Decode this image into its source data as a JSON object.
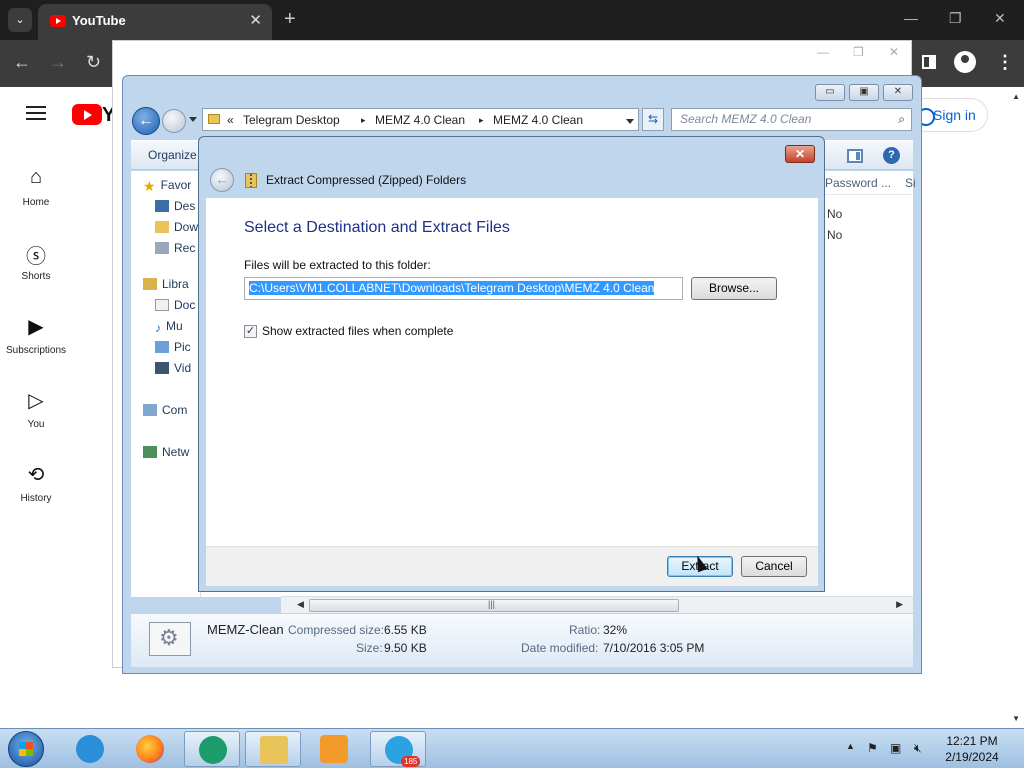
{
  "browser": {
    "tab_title": "YouTube",
    "tab_close": "✕",
    "new_tab": "+",
    "menu_chevron": "⌄",
    "minimize": "—",
    "restore": "❐",
    "close": "✕",
    "back": "←",
    "forward": "→",
    "reload": "↻",
    "kebab": "⋮"
  },
  "youtube": {
    "logo_letter": "Y",
    "sign_in": "Sign in",
    "nav": [
      {
        "label": "Home",
        "icon": "home-icon",
        "glyph": "⌂"
      },
      {
        "label": "Shorts",
        "icon": "shorts-icon",
        "glyph": "ⓢ"
      },
      {
        "label": "Subscriptions",
        "icon": "subscriptions-icon",
        "glyph": "▶"
      },
      {
        "label": "You",
        "icon": "you-icon",
        "glyph": "▷"
      },
      {
        "label": "History",
        "icon": "history-icon",
        "glyph": "⟲"
      }
    ]
  },
  "explorer": {
    "window_buttons": {
      "minimize": "▭",
      "maximize": "▣",
      "close": "✕"
    },
    "address_chevrons": "«",
    "breadcrumb": [
      "Telegram Desktop",
      "MEMZ 4.0 Clean",
      "MEMZ 4.0 Clean"
    ],
    "breadcrumb_sep": "▸",
    "search_placeholder": "Search MEMZ 4.0 Clean",
    "organize": "Organize",
    "help": "?",
    "nav_pane": [
      {
        "label": "Favor",
        "icon": "star-icon"
      },
      {
        "label": "Des",
        "icon": "desktop-icon"
      },
      {
        "label": "Dow",
        "icon": "downloads-icon"
      },
      {
        "label": "Rec",
        "icon": "recent-places-icon"
      },
      {
        "label": "Libra",
        "icon": "libraries-icon"
      },
      {
        "label": "Doc",
        "icon": "documents-icon"
      },
      {
        "label": "Mu",
        "icon": "music-icon"
      },
      {
        "label": "Pic",
        "icon": "pictures-icon"
      },
      {
        "label": "Vid",
        "icon": "videos-icon"
      },
      {
        "label": "Com",
        "icon": "computer-icon"
      },
      {
        "label": "Netw",
        "icon": "network-icon"
      }
    ],
    "columns": [
      "Password ...",
      "Si"
    ],
    "cells": [
      "No",
      "No"
    ],
    "details": {
      "name": "MEMZ-Clean",
      "compressed_label": "Compressed size:",
      "compressed_value": "6.55 KB",
      "size_label": "Size:",
      "size_value": "9.50 KB",
      "ratio_label": "Ratio:",
      "ratio_value": "32%",
      "modified_label": "Date modified:",
      "modified_value": "7/10/2016 3:05 PM"
    }
  },
  "dialog": {
    "title": "Extract Compressed (Zipped) Folders",
    "close": "✕",
    "heading": "Select a Destination and Extract Files",
    "folder_label": "Files will be extracted to this folder:",
    "path": "C:\\Users\\VM1.COLLABNET\\Downloads\\Telegram Desktop\\MEMZ 4.0 Clean",
    "browse": "Browse...",
    "checkbox_label": "Show extracted files when complete",
    "checkbox_checked": true,
    "extract": "Extract",
    "cancel": "Cancel"
  },
  "taskbar": {
    "apps": [
      {
        "name": "internet-explorer",
        "color": "#2a8fd8"
      },
      {
        "name": "firefox",
        "color": "#ff7a1a"
      },
      {
        "name": "app-green",
        "color": "#1b9c6a"
      },
      {
        "name": "file-explorer",
        "color": "#e8c45a"
      },
      {
        "name": "media-player",
        "color": "#f39b2a"
      },
      {
        "name": "telegram",
        "color": "#2aa3e0",
        "badge": "185"
      }
    ],
    "time": "12:21 PM",
    "date": "2/19/2024"
  },
  "colors": {
    "youtube_red": "#ff0000",
    "selection_blue": "#3399ff",
    "heading_blue": "#1e3287"
  }
}
